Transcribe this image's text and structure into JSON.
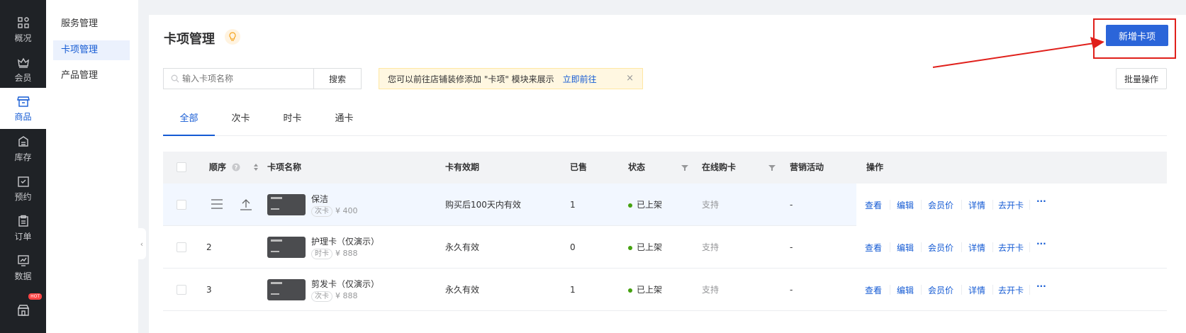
{
  "rail": [
    {
      "label": "概况",
      "icon": "grid-icon"
    },
    {
      "label": "会员",
      "icon": "crown-icon"
    },
    {
      "label": "商品",
      "icon": "store-icon"
    },
    {
      "label": "库存",
      "icon": "box-icon"
    },
    {
      "label": "预约",
      "icon": "calendar-check-icon"
    },
    {
      "label": "订单",
      "icon": "clipboard-icon"
    },
    {
      "label": "数据",
      "icon": "chart-icon"
    },
    {
      "label": "",
      "icon": "shop-icon",
      "badge": "HOT"
    }
  ],
  "subnav": [
    "服务管理",
    "卡项管理",
    "产品管理"
  ],
  "header": {
    "title": "卡项管理",
    "new_button": "新增卡项"
  },
  "search": {
    "placeholder": "输入卡项名称",
    "button": "搜索"
  },
  "notice": {
    "text": "您可以前往店铺装修添加 \"卡项\" 模块来展示",
    "link": "立即前往",
    "close": "×"
  },
  "batch_button": "批量操作",
  "tabs": [
    "全部",
    "次卡",
    "时卡",
    "通卡"
  ],
  "columns": {
    "order": "顺序",
    "name": "卡项名称",
    "validity": "卡有效期",
    "sold": "已售",
    "status": "状态",
    "online": "在线购卡",
    "marketing": "营销活动",
    "ops": "操作"
  },
  "rows": [
    {
      "order": "",
      "name": "保洁",
      "type": "次卡",
      "price": "¥ 400",
      "validity": "购买后100天内有效",
      "sold": "1",
      "status": "已上架",
      "online": "支持",
      "marketing": "-"
    },
    {
      "order": "2",
      "name": "护理卡（仅演示）",
      "type": "时卡",
      "price": "¥ 888",
      "validity": "永久有效",
      "sold": "0",
      "status": "已上架",
      "online": "支持",
      "marketing": "-"
    },
    {
      "order": "3",
      "name": "剪发卡（仅演示）",
      "type": "次卡",
      "price": "¥ 888",
      "validity": "永久有效",
      "sold": "1",
      "status": "已上架",
      "online": "支持",
      "marketing": "-"
    }
  ],
  "row_actions": [
    "查看",
    "编辑",
    "会员价",
    "详情",
    "去开卡",
    "···"
  ],
  "colors": {
    "primary": "#2b65d9",
    "highlight": "#e0201b",
    "status_on": "#45a110"
  }
}
